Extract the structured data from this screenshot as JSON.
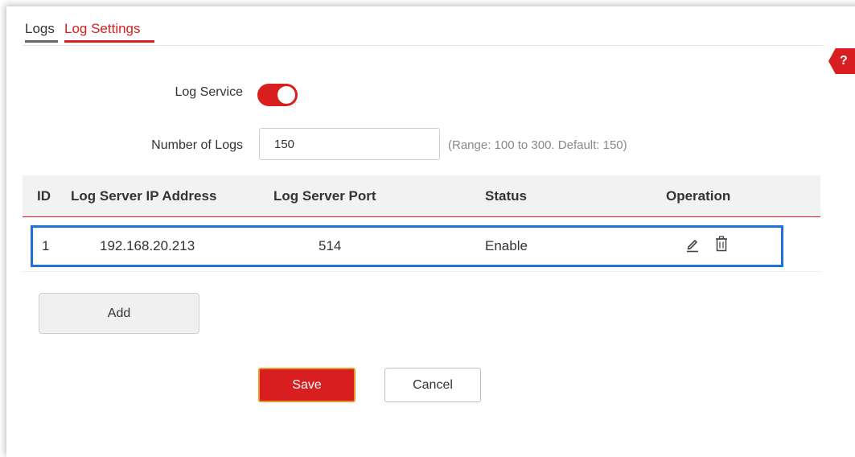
{
  "tabs": [
    {
      "label": "Logs",
      "active": false
    },
    {
      "label": "Log Settings",
      "active": true
    }
  ],
  "help": {
    "label": "?"
  },
  "form": {
    "log_service": {
      "label": "Log Service",
      "enabled": true
    },
    "number_of_logs": {
      "label": "Number of Logs",
      "value": "150",
      "hint": "(Range: 100 to 300. Default: 150)"
    }
  },
  "table": {
    "headers": [
      "ID",
      "Log Server IP Address",
      "Log Server Port",
      "Status",
      "Operation"
    ],
    "rows": [
      {
        "id": "1",
        "ip": "192.168.20.213",
        "port": "514",
        "status": "Enable",
        "operations": [
          "edit-icon",
          "trash-icon"
        ]
      }
    ]
  },
  "buttons": {
    "add": "Add",
    "save": "Save",
    "cancel": "Cancel"
  },
  "colors": {
    "accent": "#d81e1e",
    "highlight": "#1f73d8",
    "header_bg": "#f2f2f2"
  }
}
